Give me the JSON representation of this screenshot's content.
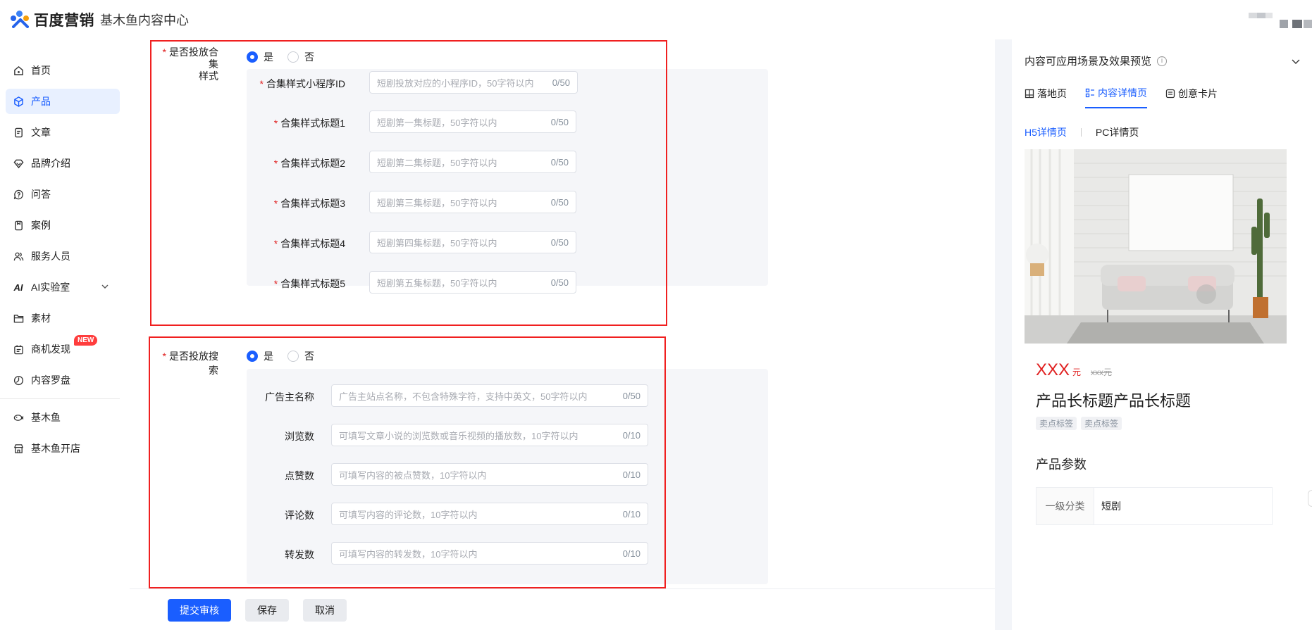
{
  "header": {
    "brand": "百度营销",
    "subtitle": "基木鱼内容中心"
  },
  "sidebar": {
    "items": [
      {
        "label": "首页",
        "icon": "home-icon"
      },
      {
        "label": "产品",
        "icon": "cube-icon",
        "active": true
      },
      {
        "label": "文章",
        "icon": "document-icon"
      },
      {
        "label": "品牌介绍",
        "icon": "diamond-icon"
      },
      {
        "label": "问答",
        "icon": "question-icon"
      },
      {
        "label": "案例",
        "icon": "case-icon"
      },
      {
        "label": "服务人员",
        "icon": "people-icon"
      },
      {
        "label": "AI实验室",
        "icon": "ai-icon"
      },
      {
        "label": "素材",
        "icon": "folder-icon"
      },
      {
        "label": "商机发现",
        "icon": "opportunity-icon",
        "badge": "NEW"
      },
      {
        "label": "内容罗盘",
        "icon": "compass-icon"
      }
    ],
    "bottom_items": [
      {
        "label": "基木鱼",
        "icon": "fish-icon"
      },
      {
        "label": "基木鱼开店",
        "icon": "shop-icon"
      }
    ]
  },
  "form": {
    "collection": {
      "label_line1": "是否投放合集",
      "label_line2": "样式",
      "yes": "是",
      "no": "否",
      "selected": "是",
      "fields": [
        {
          "label": "合集样式小程序ID",
          "placeholder": "短剧投放对应的小程序ID，50字符以内",
          "count": "0/50"
        },
        {
          "label": "合集样式标题1",
          "placeholder": "短剧第一集标题，50字符以内",
          "count": "0/50"
        },
        {
          "label": "合集样式标题2",
          "placeholder": "短剧第二集标题，50字符以内",
          "count": "0/50"
        },
        {
          "label": "合集样式标题3",
          "placeholder": "短剧第三集标题，50字符以内",
          "count": "0/50"
        },
        {
          "label": "合集样式标题4",
          "placeholder": "短剧第四集标题，50字符以内",
          "count": "0/50"
        },
        {
          "label": "合集样式标题5",
          "placeholder": "短剧第五集标题，50字符以内",
          "count": "0/50"
        }
      ]
    },
    "search": {
      "label": "是否投放搜索",
      "yes": "是",
      "no": "否",
      "selected": "是",
      "fields": [
        {
          "label": "广告主名称",
          "placeholder": "广告主站点名称，不包含特殊字符，支持中英文，50字符以内",
          "count": "0/50"
        },
        {
          "label": "浏览数",
          "placeholder": "可填写文章小说的浏览数或音乐视频的播放数，10字符以内",
          "count": "0/10"
        },
        {
          "label": "点赞数",
          "placeholder": "可填写内容的被点赞数，10字符以内",
          "count": "0/10"
        },
        {
          "label": "评论数",
          "placeholder": "可填写内容的评论数，10字符以内",
          "count": "0/10"
        },
        {
          "label": "转发数",
          "placeholder": "可填写内容的转发数，10字符以内",
          "count": "0/10"
        }
      ]
    }
  },
  "footer": {
    "submit": "提交审核",
    "save": "保存",
    "cancel": "取消"
  },
  "preview": {
    "title": "内容可应用场景及效果预览",
    "tabs": [
      "落地页",
      "内容详情页",
      "创意卡片"
    ],
    "active_tab": "内容详情页",
    "subtabs": [
      "H5详情页",
      "PC详情页"
    ],
    "active_subtab": "H5详情页",
    "price": "XXX",
    "price_unit": "元",
    "price_old": "xxx元",
    "product_title": "产品长标题产品长标题",
    "tags": [
      "卖点标签",
      "卖点标签"
    ],
    "params_title": "产品参数",
    "params": [
      {
        "key": "一级分类",
        "value": "短剧"
      }
    ]
  },
  "colors": {
    "accent": "#1a5eff",
    "required": "#e02020",
    "highlight_box": "#f02020"
  }
}
